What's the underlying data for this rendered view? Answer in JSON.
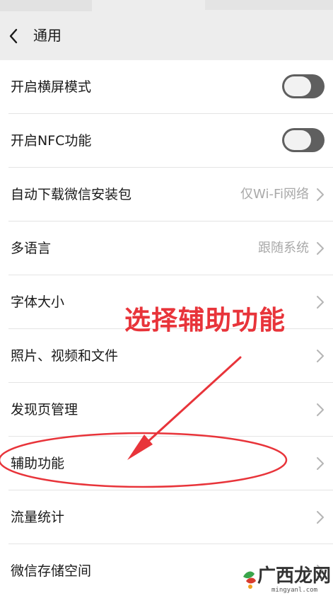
{
  "header": {
    "title": "通用"
  },
  "settings": [
    {
      "label": "开启横屏模式",
      "type": "toggle",
      "on": false
    },
    {
      "label": "开启NFC功能",
      "type": "toggle",
      "on": false
    },
    {
      "label": "自动下载微信安装包",
      "type": "link",
      "value": "仅Wi-Fi网络"
    },
    {
      "label": "多语言",
      "type": "link",
      "value": "跟随系统"
    },
    {
      "label": "字体大小",
      "type": "link"
    },
    {
      "label": "照片、视频和文件",
      "type": "link"
    },
    {
      "label": "发现页管理",
      "type": "link"
    },
    {
      "label": "辅助功能",
      "type": "link"
    },
    {
      "label": "流量统计",
      "type": "link"
    },
    {
      "label": "微信存储空间",
      "type": "link"
    }
  ],
  "annotation": {
    "text": "选择辅助功能",
    "color": "#e8343a"
  },
  "watermark": {
    "text": "广西龙网",
    "url": "mingyanl.com"
  },
  "colors": {
    "toggle_off": "#5f5f5f",
    "header_bg": "#ededed",
    "value_text": "#a9a9a9"
  },
  "icons": {
    "back": "chevron-left-icon",
    "row": "chevron-right-icon"
  }
}
